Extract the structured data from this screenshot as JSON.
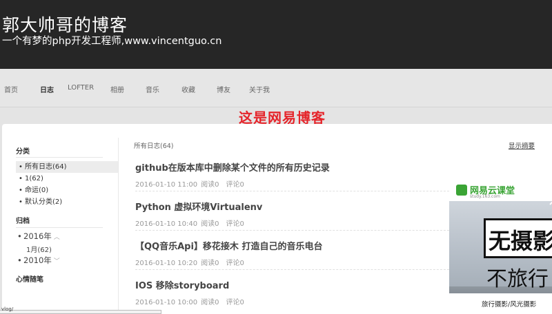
{
  "header": {
    "title": "郭大帅哥的博客",
    "subtitle": "一个有梦的php开发工程师,www.vincentguo.cn"
  },
  "nav": {
    "items": [
      "首页",
      "日志",
      "LOFTER",
      "相册",
      "音乐",
      "收藏",
      "博友",
      "关于我"
    ],
    "active": "日志"
  },
  "annotation": "这是网易博客",
  "sidebar": {
    "category_heading": "分类",
    "categories": [
      {
        "label": "所有日志(64)"
      },
      {
        "label": "1(62)"
      },
      {
        "label": "命运(0)"
      },
      {
        "label": "默认分类(2)"
      }
    ],
    "archive_heading": "归档",
    "archive": {
      "year1": "2016年",
      "month1": "1月(62)",
      "year2": "2010年"
    },
    "mood_heading": "心情随笔"
  },
  "main": {
    "heading": "所有日志(64)",
    "show_summary": "显示摘要",
    "posts": [
      {
        "title": "github在版本库中删除某个文件的所有历史记录",
        "date": "2016-01-10 11:00",
        "reads": "阅读0",
        "comments": "评论0"
      },
      {
        "title": "Python 虚拟环境Virtualenv",
        "date": "2016-01-10 10:40",
        "reads": "阅读0",
        "comments": "评论0"
      },
      {
        "title": "【QQ音乐Api】移花接木 打造自己的音乐电台",
        "date": "2016-01-10 10:20",
        "reads": "阅读0",
        "comments": "评论0"
      },
      {
        "title": "IOS 移除storyboard",
        "date": "2016-01-10 10:00",
        "reads": "阅读0",
        "comments": "评论0"
      }
    ]
  },
  "ad": {
    "logo": "网易云课堂",
    "url": "study.163.com",
    "text1": "无摄影",
    "text2": "不旅行",
    "caption": "旅行摄影/风光摄影"
  },
  "status_bar": "vlog/",
  "colors": {
    "header_bg": "#262626",
    "annotation": "#e5242a",
    "ad_green": "#3aa435"
  }
}
